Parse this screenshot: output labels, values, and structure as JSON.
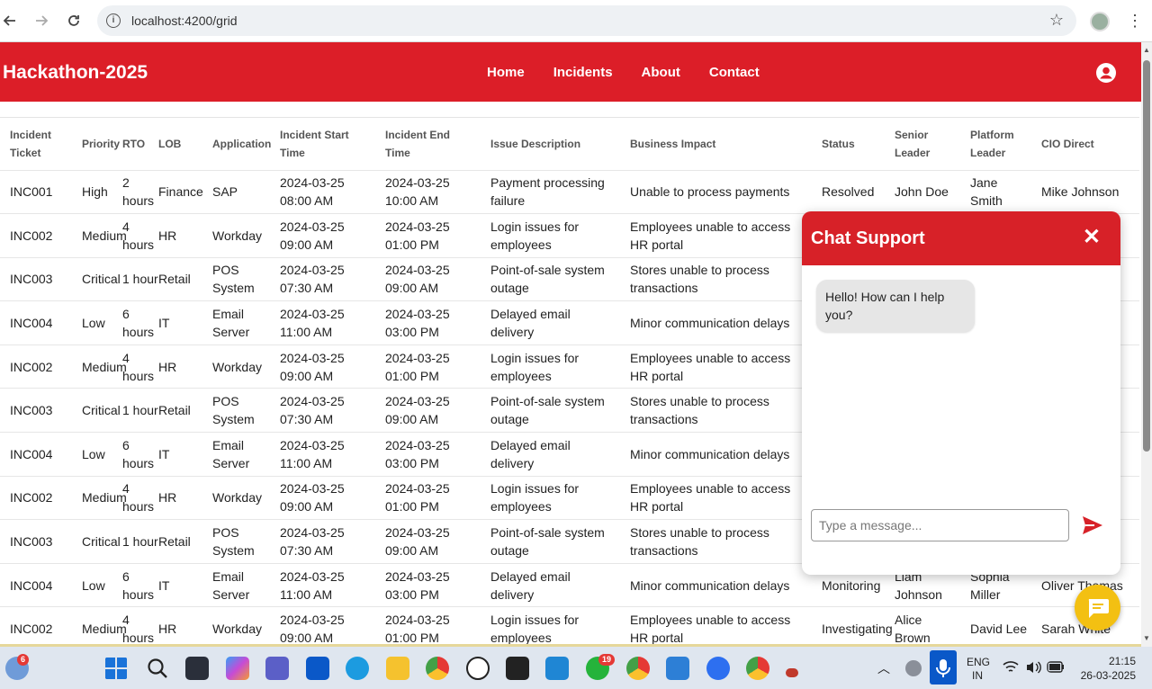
{
  "browser": {
    "url": "localhost:4200/grid"
  },
  "header": {
    "brand": "Hackathon-2025",
    "nav": [
      "Home",
      "Incidents",
      "About",
      "Contact"
    ]
  },
  "table": {
    "columns": [
      "Incident Ticket",
      "Priority",
      "RTO",
      "LOB",
      "Application",
      "Incident Start Time",
      "Incident End Time",
      "Issue Description",
      "Business Impact",
      "Status",
      "Senior Leader",
      "Platform Leader",
      "CIO Direct"
    ],
    "rows": [
      [
        "INC001",
        "High",
        "2 hours",
        "Finance",
        "SAP",
        "2024-03-25 08:00 AM",
        "2024-03-25 10:00 AM",
        "Payment processing failure",
        "Unable to process payments",
        "Resolved",
        "John Doe",
        "Jane Smith",
        "Mike Johnson"
      ],
      [
        "INC002",
        "Medium",
        "4 hours",
        "HR",
        "Workday",
        "2024-03-25 09:00 AM",
        "2024-03-25 01:00 PM",
        "Login issues for employees",
        "Employees unable to access HR portal",
        "",
        "",
        "",
        ""
      ],
      [
        "INC003",
        "Critical",
        "1 hour",
        "Retail",
        "POS System",
        "2024-03-25 07:30 AM",
        "2024-03-25 09:00 AM",
        "Point-of-sale system outage",
        "Stores unable to process transactions",
        "",
        "",
        "",
        ""
      ],
      [
        "INC004",
        "Low",
        "6 hours",
        "IT",
        "Email Server",
        "2024-03-25 11:00 AM",
        "2024-03-25 03:00 PM",
        "Delayed email delivery",
        "Minor communication delays",
        "",
        "",
        "",
        ""
      ],
      [
        "INC002",
        "Medium",
        "4 hours",
        "HR",
        "Workday",
        "2024-03-25 09:00 AM",
        "2024-03-25 01:00 PM",
        "Login issues for employees",
        "Employees unable to access HR portal",
        "",
        "",
        "",
        ""
      ],
      [
        "INC003",
        "Critical",
        "1 hour",
        "Retail",
        "POS System",
        "2024-03-25 07:30 AM",
        "2024-03-25 09:00 AM",
        "Point-of-sale system outage",
        "Stores unable to process transactions",
        "",
        "",
        "",
        ""
      ],
      [
        "INC004",
        "Low",
        "6 hours",
        "IT",
        "Email Server",
        "2024-03-25 11:00 AM",
        "2024-03-25 03:00 PM",
        "Delayed email delivery",
        "Minor communication delays",
        "",
        "",
        "",
        ""
      ],
      [
        "INC002",
        "Medium",
        "4 hours",
        "HR",
        "Workday",
        "2024-03-25 09:00 AM",
        "2024-03-25 01:00 PM",
        "Login issues for employees",
        "Employees unable to access HR portal",
        "",
        "",
        "",
        ""
      ],
      [
        "INC003",
        "Critical",
        "1 hour",
        "Retail",
        "POS System",
        "2024-03-25 07:30 AM",
        "2024-03-25 09:00 AM",
        "Point-of-sale system outage",
        "Stores unable to process transactions",
        "",
        "",
        "",
        ""
      ],
      [
        "INC004",
        "Low",
        "6 hours",
        "IT",
        "Email Server",
        "2024-03-25 11:00 AM",
        "2024-03-25 03:00 PM",
        "Delayed email delivery",
        "Minor communication delays",
        "Monitoring",
        "Liam Johnson",
        "Sophia Miller",
        "Oliver Thomas"
      ],
      [
        "INC002",
        "Medium",
        "4 hours",
        "HR",
        "Workday",
        "2024-03-25 09:00 AM",
        "2024-03-25 01:00 PM",
        "Login issues for employees",
        "Employees unable to access HR portal",
        "Investigating",
        "Alice Brown",
        "David Lee",
        "Sarah White"
      ]
    ]
  },
  "chat": {
    "title": "Chat Support",
    "close": "✕",
    "greeting": "Hello! How can I help you?",
    "placeholder": "Type a message..."
  },
  "taskbar": {
    "badges": {
      "start_left": "6",
      "whatsapp": "19"
    },
    "lang_top": "ENG",
    "lang_bottom": "IN",
    "time": "21:15",
    "date": "26-03-2025"
  },
  "colors": {
    "brand_red": "#dc1e28",
    "chat_red": "#d72128",
    "fab_yellow": "#f3c012"
  }
}
